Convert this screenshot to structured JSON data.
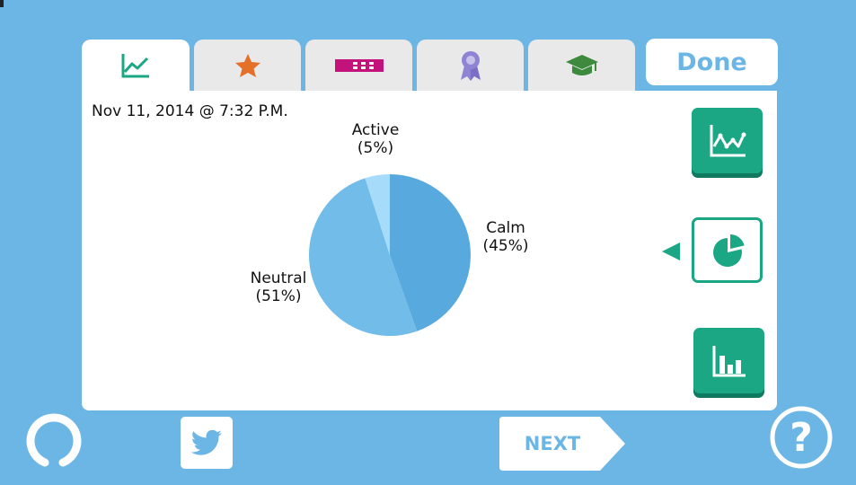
{
  "header": {
    "tabs": [
      {
        "name": "trend",
        "icon": "line-chart-icon",
        "active": true
      },
      {
        "name": "favorites",
        "icon": "star-icon",
        "active": false
      },
      {
        "name": "ticket",
        "icon": "ticket-icon",
        "active": false
      },
      {
        "name": "awards",
        "icon": "ribbon-award-icon",
        "active": false
      },
      {
        "name": "learn",
        "icon": "graduation-cap-icon",
        "active": false
      }
    ],
    "done_label": "Done"
  },
  "panel": {
    "timestamp": "Nov 11, 2014 @ 7:32 P.M."
  },
  "chart_data": {
    "type": "pie",
    "slices": [
      {
        "label": "Calm",
        "value": 45,
        "value_label": "(45%)",
        "color": "#58a9dd"
      },
      {
        "label": "Neutral",
        "value": 51,
        "value_label": "(51%)",
        "color": "#71bce8"
      },
      {
        "label": "Active",
        "value": 5,
        "value_label": "(5%)",
        "color": "#a6dcfa"
      }
    ]
  },
  "side_controls": {
    "views": [
      {
        "name": "line-view",
        "icon": "line-chart-icon",
        "selected": false
      },
      {
        "name": "pie-view",
        "icon": "pie-chart-icon",
        "selected": true
      },
      {
        "name": "bar-view",
        "icon": "bar-chart-icon",
        "selected": false
      }
    ]
  },
  "footer": {
    "next_label": "NEXT",
    "help_label": "?"
  },
  "colors": {
    "background": "#6cb6e6",
    "accent": "#1ba784",
    "star": "#e5702a",
    "ticket": "#c4127b",
    "ribbon": "#8f84d4",
    "cap": "#3d8a3d"
  }
}
